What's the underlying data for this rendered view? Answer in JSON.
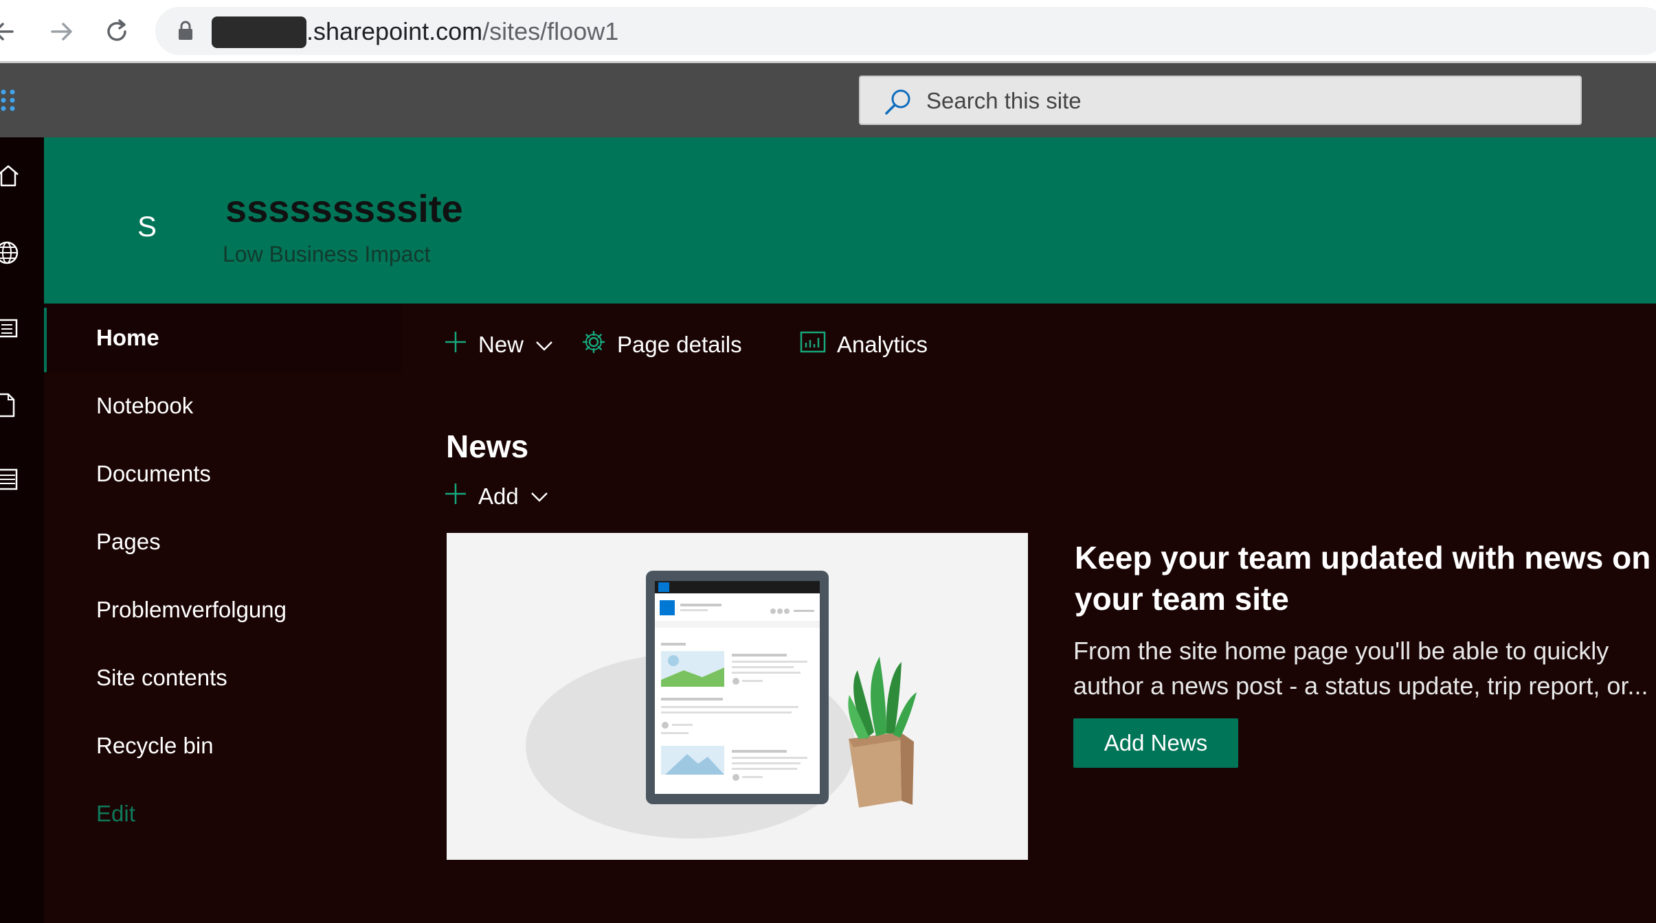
{
  "browser": {
    "url_host": ".sharepoint.com",
    "url_path": "/sites/floow1"
  },
  "suite_bar": {
    "search_placeholder": "Search this site"
  },
  "site": {
    "logo_letter": "S",
    "title": "sssssssssite",
    "classification": "Low Business Impact"
  },
  "quick_launch": {
    "items": [
      {
        "label": "Home"
      },
      {
        "label": "Notebook"
      },
      {
        "label": "Documents"
      },
      {
        "label": "Pages"
      },
      {
        "label": "Problemverfolgung"
      },
      {
        "label": "Site contents"
      },
      {
        "label": "Recycle bin"
      }
    ],
    "edit_label": "Edit"
  },
  "command_bar": {
    "new_label": "New",
    "page_details_label": "Page details",
    "analytics_label": "Analytics"
  },
  "news": {
    "title": "News",
    "add_label": "Add",
    "heading": "Keep your team updated with news on your team site",
    "description_line1": "From the site home page you'll be able to quickly",
    "description_line2": "author a news post - a status update, trip report, or...",
    "add_news_label": "Add News"
  },
  "colors": {
    "brand": "#017558",
    "page_background": "#1a0404",
    "suite_bar": "#4a4a4a"
  }
}
